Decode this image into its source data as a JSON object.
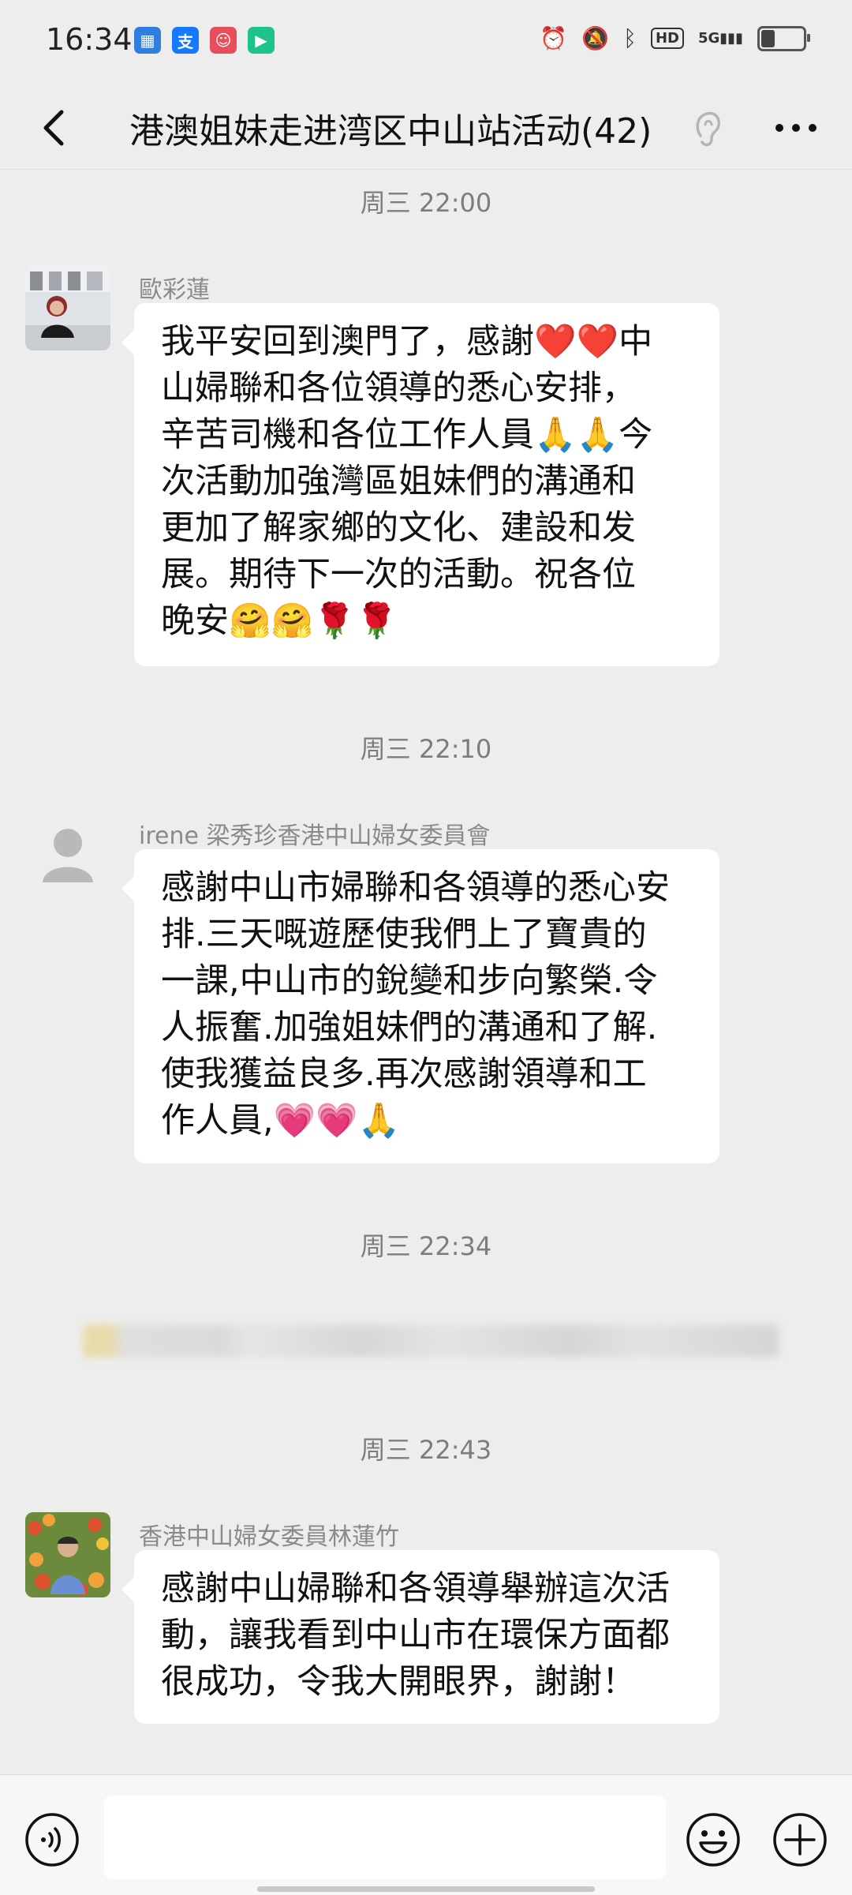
{
  "status_bar": {
    "time": "16:34",
    "app_icons": [
      "grid-app-icon",
      "alipay-icon",
      "mascot-app-icon",
      "video-app-icon"
    ],
    "hd_label": "HD",
    "network": "5G"
  },
  "chat": {
    "title": "港澳姐妹走进湾区中山站活动(42)",
    "messages": [
      {
        "timestamp": "周三 22:00",
        "sender": "歐彩蓮",
        "lines": [
          "我平安回到澳門了，感謝❤️❤️中",
          "山婦聯和各位領導的悉心安排，",
          "辛苦司機和各位工作人員🙏🙏今",
          "次活動加強灣區姐妹們的溝通和",
          "更加了解家鄉的文化、建設和发",
          "展。期待下一次的活動。祝各位",
          "晚安🤗🤗🌹🌹"
        ]
      },
      {
        "timestamp": "周三 22:10",
        "sender": "irene 梁秀珍香港中山婦女委員會",
        "lines": [
          "感謝中山市婦聯和各領導的悉心安",
          "排.三天嘅遊歷使我們上了寶貴的",
          "一課,中山市的銳變和步向繁榮.令",
          "人振奮.加強姐妹們的溝通和了解.",
          "使我獲益良多.再次感謝領導和工",
          "作人員,💗💗🙏"
        ]
      },
      {
        "timestamp": "周三 22:34"
      },
      {
        "timestamp": "周三 22:43",
        "sender": "香港中山婦女委員林蓮竹",
        "lines": [
          "感謝中山婦聯和各領導舉辦這次活",
          "動，讓我看到中山市在環保方面都",
          "很成功，令我大開眼界，謝謝！"
        ]
      }
    ]
  },
  "colors": {
    "background": "#ededed",
    "bubble": "#ffffff",
    "meta_text": "#7d7d7d"
  }
}
